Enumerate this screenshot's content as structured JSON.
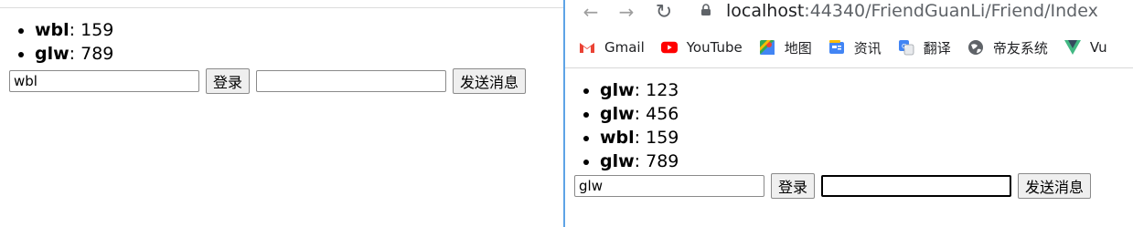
{
  "left": {
    "messages": [
      {
        "user": "wbl",
        "text": "159"
      },
      {
        "user": "glw",
        "text": "789"
      }
    ],
    "controls": {
      "username_value": "wbl",
      "login_label": "登录",
      "message_value": "",
      "send_label": "发送消息"
    }
  },
  "right": {
    "browser": {
      "url_host": "localhost",
      "url_path": ":44340/FriendGuanLi/Friend/Index",
      "bookmarks": [
        {
          "label": "Gmail",
          "icon": "gmail-icon"
        },
        {
          "label": "YouTube",
          "icon": "youtube-icon"
        },
        {
          "label": "地图",
          "icon": "maps-icon"
        },
        {
          "label": "资讯",
          "icon": "news-icon"
        },
        {
          "label": "翻译",
          "icon": "translate-icon"
        },
        {
          "label": "帝友系统",
          "icon": "globe-icon"
        },
        {
          "label": "Vu",
          "icon": "vue-icon"
        }
      ]
    },
    "messages": [
      {
        "user": "glw",
        "text": "123"
      },
      {
        "user": "glw",
        "text": "456"
      },
      {
        "user": "wbl",
        "text": "159"
      },
      {
        "user": "glw",
        "text": "789"
      }
    ],
    "controls": {
      "username_value": "glw",
      "login_label": "登录",
      "message_value": "",
      "send_label": "发送消息"
    }
  },
  "colors": {
    "focus_blue": "#5ea3e6",
    "gmail_red": "#ea4335",
    "youtube_red": "#ff0000",
    "vue_green": "#42b883"
  }
}
